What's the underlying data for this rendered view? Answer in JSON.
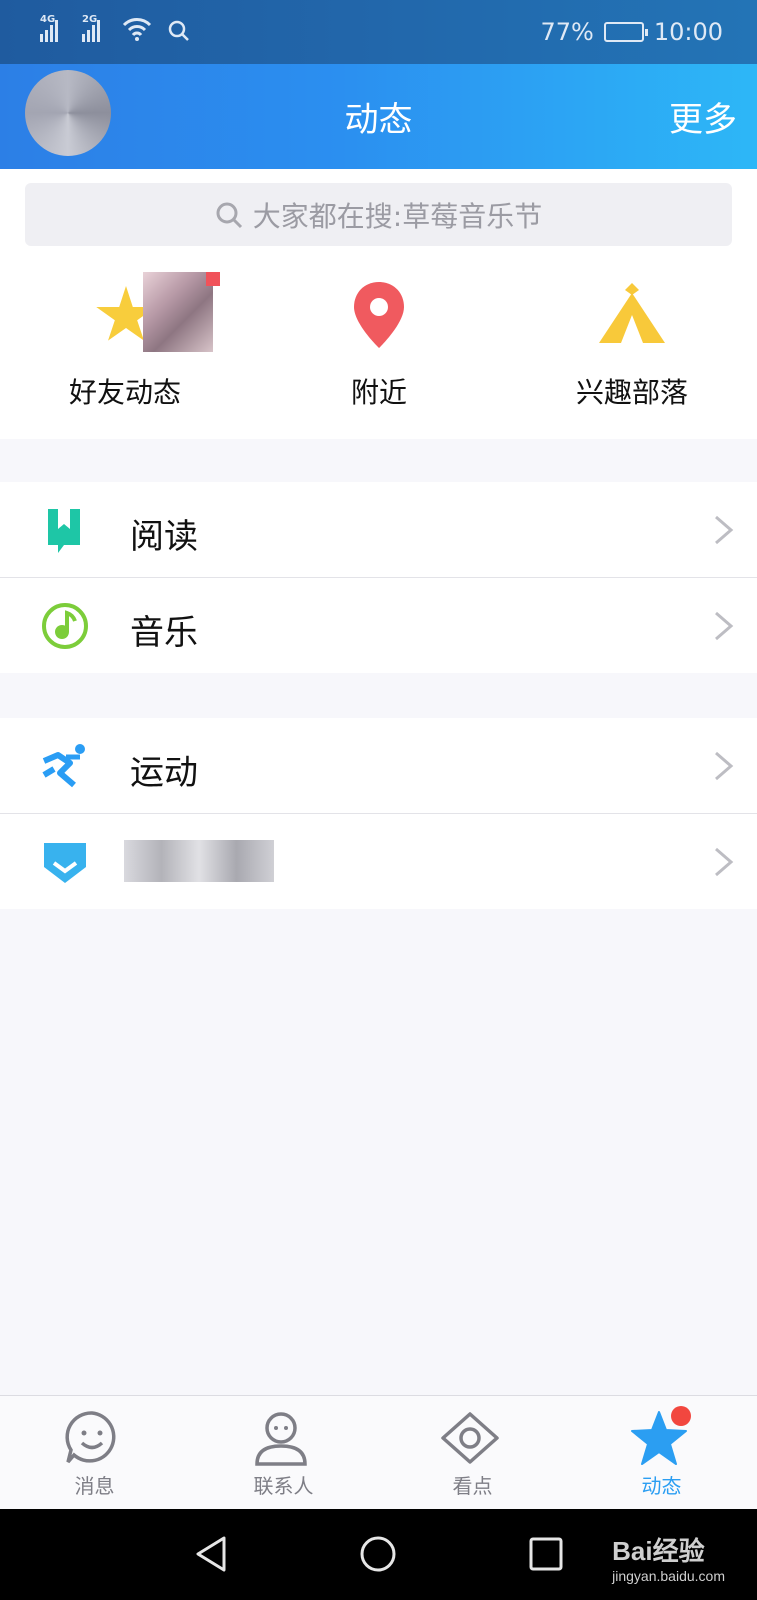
{
  "status_bar": {
    "network1": "4G",
    "network2": "2G",
    "battery": "77%",
    "battery_level": 0.77,
    "time": "10:00"
  },
  "nav": {
    "title": "动态",
    "more": "更多"
  },
  "search": {
    "placeholder": "大家都在搜:草莓音乐节"
  },
  "shortcuts": [
    {
      "label": "好友动态",
      "icon": "friends-feed-icon"
    },
    {
      "label": "附近",
      "icon": "location-pin-icon",
      "color": "#f05a5f"
    },
    {
      "label": "兴趣部落",
      "icon": "tent-icon",
      "color": "#f8c93a"
    }
  ],
  "section1": [
    {
      "label": "阅读",
      "icon": "bookmark-book-icon",
      "color": "#1ec6a6"
    },
    {
      "label": "音乐",
      "icon": "music-note-icon",
      "color": "#7ccd3a"
    }
  ],
  "section2": [
    {
      "label": "运动",
      "icon": "running-icon",
      "color": "#2a9df4"
    },
    {
      "label": "",
      "icon": "shield-icon",
      "color": "#38b2ee"
    }
  ],
  "tabs": [
    {
      "label": "消息",
      "icon": "smiley-chat-icon"
    },
    {
      "label": "联系人",
      "icon": "contact-person-icon"
    },
    {
      "label": "看点",
      "icon": "eye-icon"
    },
    {
      "label": "动态",
      "icon": "star-icon",
      "active": true
    }
  ],
  "watermark": {
    "brand": "Bai经验",
    "url": "jingyan.baidu.com"
  },
  "colors": {
    "header_start": "#2c7fe6",
    "header_end": "#2db7f7",
    "active_tab": "#2b9ef2",
    "badge": "#f2473f"
  }
}
